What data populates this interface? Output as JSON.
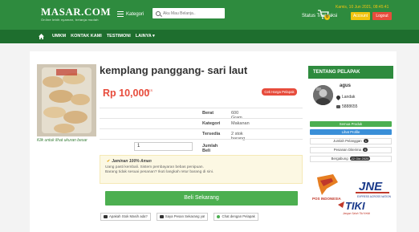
{
  "brand": {
    "name": "MASAR.COM",
    "tagline": "Online lebih nyaman, belanja mudah"
  },
  "header": {
    "kategori_label": "Kategori",
    "search_placeholder": "Aku Mau Belanja..",
    "status_transaksi": "Status Transaksi",
    "cart_count": "0",
    "datetime": "Kamis, 10 Jun 2021, 08:45:41",
    "account_label": "Account",
    "logout_label": "Logout"
  },
  "nav": {
    "items": [
      "UMKM",
      "KONTAK KAMI",
      "TESTIMONI",
      "LAINYA ▾"
    ]
  },
  "product": {
    "title": "kemplang panggang- sari laut",
    "price": "Rp 10,000",
    "price_unit": "pcs",
    "cek_ongkir": "Cek Harga Pelapak",
    "image_caption": "Klik untuk lihat ukuran besar",
    "specs": [
      {
        "key": "Berat",
        "value": "600 Gram"
      },
      {
        "key": "Kategori",
        "value": "Makanan"
      },
      {
        "key": "Tersedia",
        "value": "2 stok barang"
      }
    ],
    "qty_label": "Jumlah Beli",
    "qty_value": "1",
    "guarantee_title": "Jaminan 100% Aman",
    "guarantee_line1": "Uang pasti kembali. Sistem pembayaran bebas penipuan.",
    "guarantee_line2": "Barang tidak sesuai pesanan? Ikuti langkah retur barang di sini.",
    "buy_label": "Beli Sekarang",
    "chat_buttons": [
      "Apakah Stok Masih ada?",
      "Saya Pesan Sekarang ya!",
      "Chat dengan Pelapak"
    ]
  },
  "seller": {
    "heading": "TENTANG PELAPAK",
    "name": "agus",
    "location": "Landak",
    "phone": "5888655",
    "semua_produk": "Semua Produk",
    "lihat_profile": "Lihat Profile",
    "stats": [
      {
        "label": "Jumlah Pelanggan",
        "badge": "1"
      },
      {
        "label": "Pesanan Diterima",
        "badge": "0"
      },
      {
        "label": "Bergabung",
        "badge": "22 Okt 2020"
      }
    ],
    "courier_label_pos": "POS INDONESIA",
    "courier_label_jne": "JNE",
    "courier_jne_sub": "EXPRESS ACROSS NATION",
    "courier_label_tiki": "TIKI",
    "courier_tiki_sub": "Jangan Salah Tiki Ketiki"
  },
  "colors": {
    "header_green": "#2e8b3e",
    "nav_green": "#1e6e2e",
    "price_red": "#e74c3c",
    "buy_green": "#4caf50",
    "accent_yellow": "#f1c40f"
  }
}
